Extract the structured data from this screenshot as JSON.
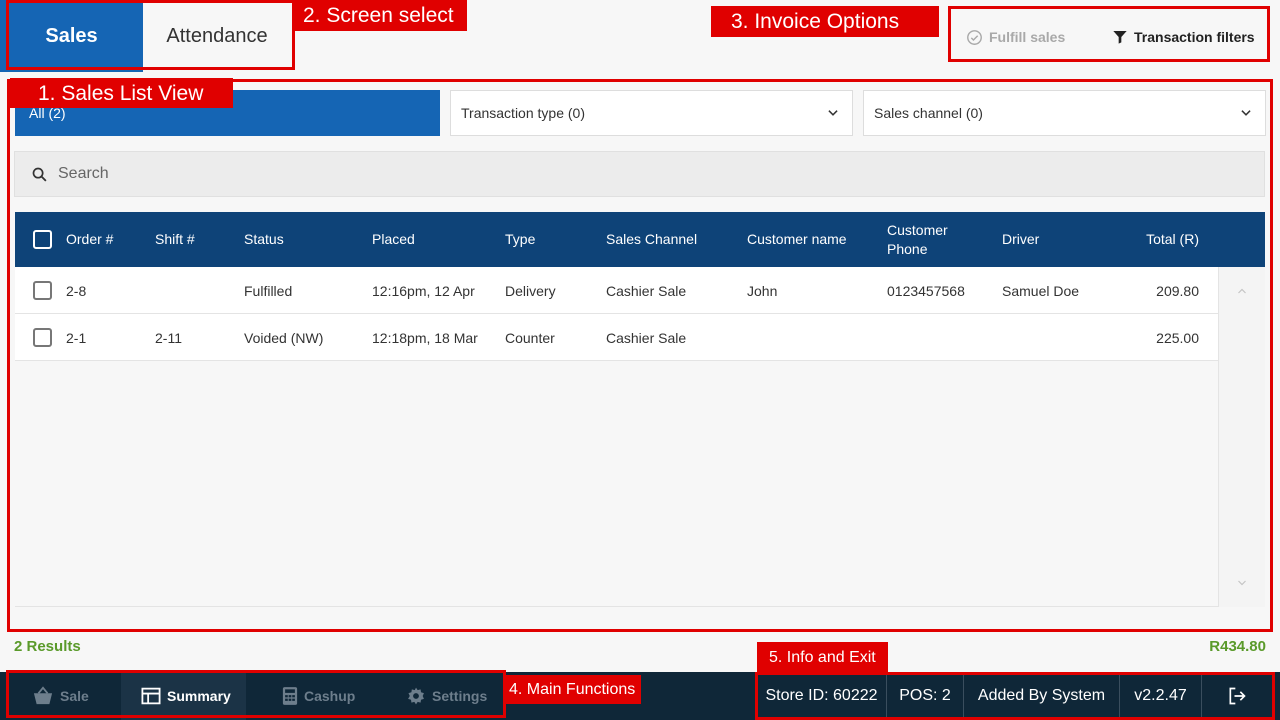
{
  "screen_tabs": {
    "sales": "Sales",
    "attendance": "Attendance"
  },
  "invoice_options": {
    "fulfill": "Fulfill sales",
    "filters": "Transaction filters"
  },
  "filters": {
    "all": "All (2)",
    "transaction_type": "Transaction type (0)",
    "sales_channel": "Sales channel (0)"
  },
  "search": {
    "placeholder": "Search"
  },
  "table": {
    "headers": [
      "Order #",
      "Shift #",
      "Status",
      "Placed",
      "Type",
      "Sales Channel",
      "Customer name",
      "Customer Phone",
      "Driver",
      "Total (R)"
    ],
    "rows": [
      {
        "order": "2-8",
        "shift": "",
        "status": "Fulfilled",
        "placed": "12:16pm, 12 Apr",
        "type": "Delivery",
        "channel": "Cashier Sale",
        "customer": "John",
        "phone": "0123457568",
        "driver": "Samuel Doe",
        "total": "209.80"
      },
      {
        "order": "2-1",
        "shift": "2-11",
        "status": "Voided (NW)",
        "placed": "12:18pm, 18 Mar",
        "type": "Counter",
        "channel": "Cashier Sale",
        "customer": "",
        "phone": "",
        "driver": "",
        "total": "225.00"
      }
    ]
  },
  "summary": {
    "results": "2 Results",
    "total": "R434.80"
  },
  "nav": {
    "sale": "Sale",
    "summary": "Summary",
    "cashup": "Cashup",
    "settings": "Settings"
  },
  "info": {
    "store": "Store ID: 60222",
    "pos": "POS: 2",
    "user": "Added By System",
    "version": "v2.2.47"
  },
  "annotations": {
    "a1": "1. Sales List View",
    "a2": "2. Screen select",
    "a3": "3. Invoice Options",
    "a4": "4. Main Functions",
    "a5": "5. Info and Exit"
  },
  "colors": {
    "primary": "#1565b4",
    "header": "#0e4378",
    "annotation": "#e00000",
    "positive": "#5a9a2a",
    "bottombar": "#0f2738"
  },
  "icons": [
    "check-circle-icon",
    "filter-icon",
    "chevron-down-icon",
    "search-icon",
    "chevron-up-icon",
    "basket-icon",
    "table-icon",
    "calculator-icon",
    "gear-icon",
    "logout-icon"
  ]
}
